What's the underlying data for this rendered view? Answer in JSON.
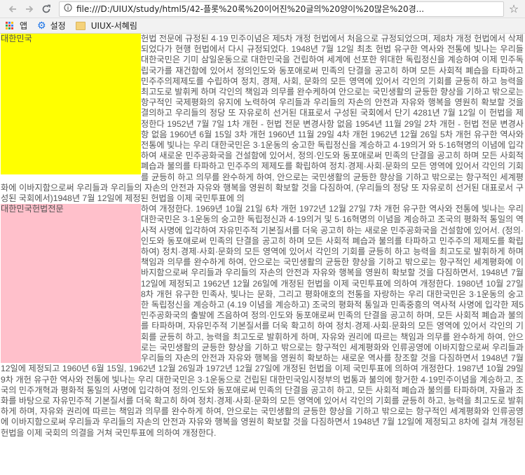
{
  "browser": {
    "url": "file:///D:/UIUX/study/html5/42-플롯%20록%20이어진%20글의%20양이%20많은%20경...",
    "back_icon": "arrow-left-icon",
    "forward_icon": "arrow-right-icon",
    "reload_icon": "reload-icon",
    "info_icon": "info-icon",
    "star_icon": "star-icon"
  },
  "bookmarks": {
    "apps_label": "앱",
    "settings_label": "설정",
    "folder_label": "UIUX-서혜림"
  },
  "content": {
    "box1_label": "대한민국",
    "box2_label": "대한민국헌법전문",
    "paragraph1": "헌법 전문에 규정된 4·19 민주이념은 제5차 개정 헌법에서 처음으로 규정되었으며, 제8차 개정 헌법에서 삭제되었다가 현행 헌법에서 다시 규정되었다. 1948년 7월 12일 최초 헌법 유구한 역사와 전통에 빛나는 우리들 대한국민은 기미 삼일운동으로 대한민국을 건립하여 세계에 선포한 위대한 독립정신을 계승하여 이제 민주독립국가를 재건함에 있어서 정의인도와 동포애로써 민족의 단결을 공고히 하며 모든 사회적 폐습을 타파하고 민주주의제제도를 수립하여 정치, 경제, 사회, 문화의 모든 영역에 있어서 각인의 기회를 균등히 하고 능력을 최고도로 발휘케 하며 각인의 책임과 의무를 완수케하여 안으로는 국민생활의 균등한 향상을 기하고 밖으로는 항구적인 국제평화의 유지에 노력하여 우리들과 우리들의 자손의 안전과 자유와 행복을 영원히 확보할 것을 결의하고 우리들의 정당 또 자유로히 선거된 대표로서 구성된 국회에서 단기 4281년 7월 12일 이 헌법을 제정한다 1952년 7월 7일 1차 개헌 - 헌법 전문 변경사항 없음 1954년 11월 29일 2차 개헌 - 헌법 전문 변경사항 없음 1960년 6월 15일 3차 개헌 1960년 11월 29일 4차 개헌 1962년 12월 26일 5차 개헌 유구한 역사와 전통에 빛나는 우리 대한국민은 3·1운동의 숭고한 독립정신을 계승하고 4·19의거 와 5·16혁명의 이념에 입각하여 새로운 민주공화국을 건설함에 있어서, 정의·인도와 동포애로써 민족의 단결을 공고히 하며 모든 사회적 폐습과 불의를 타파하고 민주주의 제제도를 확립하여 정치·경제·사회·문화의 모든 영역에 있어서 각인의 기회를 균등히 하고 의무를 완수하게 하여, 안으로는 국민생활의 균등한 향상을 기하고 밖으로는 항구적인 세계평화에 이바지함으로써 우리들과 우리들의 자손의 안전과 자유와 행복을 영원히 확보할 것을 다짐하여, (우리들의 정당 또 자유로히 선거된 대표로서 구성된 국회에서)1948년 7월 12일에 제정된 헌법을 이제 국민투표에 의",
    "paragraph2": "하여 개정한다. 1969년 10월 21일 6차 개헌 1972년 12월 27일 7차 개헌 유구한 역사와 전통에 빛나는 우리 대한국민은 3·1운동의 숭고한 독립정신과 4·19의거 및 5·16혁명의 이념을 계승하고 조국의 평화적 통일의 역사적 사명에 입각하여 자유민주적 기본질서를 더욱 공고히 하는 새로운 민주공화국을 건설함에 있어서. (정의·인도와 동포애로써 민족의 단결을 공고히 하며 모든 사회적 폐습과 불의를 타파하고 민주주의 제제도를 확립하여) 정치·경제·사회·문화의 모든 영역에 있어서 각인의 기회를 균등히 하고 능력을 최고도로 발휘하게 하며 책임과 의무를 완수하게 하여, 안으로는 국민생활의 균등한 향상을 기하고 밖으로는 항구적인 세계평화에 이바지함으로써 우리들과 우리들의 자손의 안전과 자유와 행복을 영원히 확보할 것을 다짐하면서, 1948년 7월 12일에 제정되고 1962년 12월 26일에 개정된 헌법을 이제 국민투표에 의하여 개정한다. 1980년 10월 27일 8차 개헌 유구한 민족사, 빛나는 문화, 그리고 평화애호의 전통을 자랑하는 우리 대한국민은 3·1운동의 숭고한 독립정신을 계승하고 (4.19 이념을 계승하고) 조국의 평화적 통일과 민족중흥의 역사적 사명에 입각한 제5민주공화국의 출발에 즈음하여 정의·인도와 동포애로써 민족의 단결을 공고히 하며, 모든 사회적 폐습과 불의를 타파하며, 자유민주적 기본질서를 더욱 확고히 하여 정치·경제·사회·문화의 모든 영역에 있어서 각인의 기회를 균등히 하고, 능력을 최고도로 발휘하게 하며, 자유와 권리에 따르는 책임과 의무를 완수하게 하여, 안으로는 국민생활의 균등한 향상을 기하고 밖으로는 항구적인 세계평화와 인류공영에 이바지함으로써 우리들과 우리들의 자손의 안전과 자유와 행복을 영원히 확보하는 새로운 역사를 창조할 것을 다짐하면서 1948년 7월 12일에 제정되고 1960년 6월 15일, 1962년 12월 26일과 1972년 12월 27일에 개정된 헌법을 이제 국민투표에 의하여 개정한다. 1987년 10월 29일 9차 개헌 유구한 역사와 전통에 빛나는 우리 대한국민은 3·1운동으로 건립된 대한민국임시정부의 법통과 불의에 항거한 4·19민주이념을 계승하고, 조국의 민주개혁과 평화적 통일의 사명에 입각하여 정의·인도와 동포애로써 민족의 단결을 공고히 하고, 모든 사회적 폐습과 불의를 타파하며, 자율과 조화를 바탕으로 자유민주적 기본질서를 더욱 확고히 하여 정치·경제·사회·문화의 모든 영역에 있어서 각인의 기회를 균등히 하고, 능력을 최고도로 발휘하게 하며, 자유와 권리에 따르는 책임과 의무를 완수하게 하여, 안으로는 국민생활의 균등한 향상을 기하고 밖으로는 항구적인 세계평화와 인류공영에 이바지함으로써 우리들과 우리들의 자손의 안전과 자유와 행복을 영원히 확보할 것을 다짐하면서 1948년 7월 12일에 제정되고 8차에 걸쳐 개정된 헌법을 이제 국회의 의결을 거쳐 국민투표에 의하여 개정한다."
  }
}
